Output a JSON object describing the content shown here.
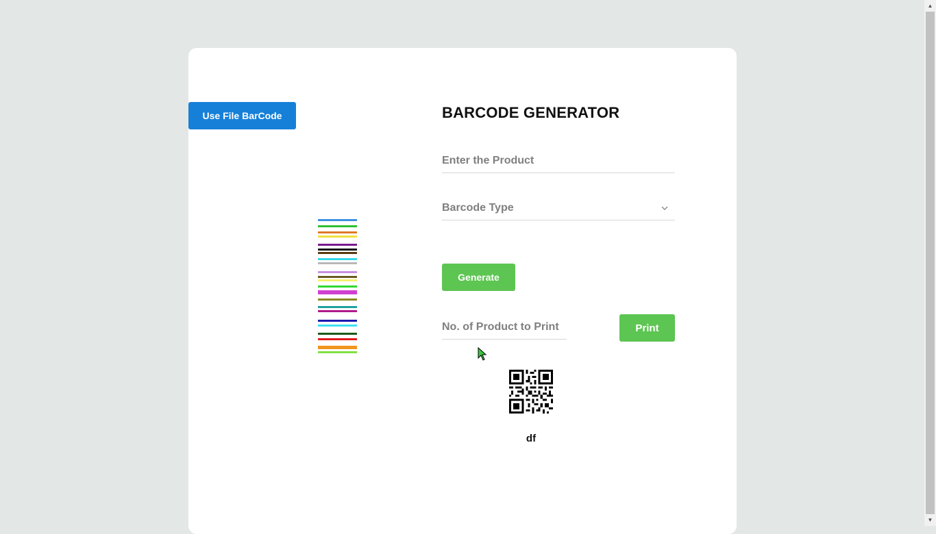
{
  "sidebar": {
    "file_barcode_button": "Use File BarCode"
  },
  "form": {
    "title": "BARCODE GENERATOR",
    "product_placeholder": "Enter the Product",
    "barcode_type_placeholder": "Barcode Type",
    "generate_label": "Generate",
    "quantity_placeholder": "No. of Product to Print",
    "print_label": "Print"
  },
  "preview": {
    "qr_text": "df"
  },
  "icons": {
    "dropdown": "chevron-down-icon",
    "illustration": "barcode-stripes-illustration",
    "qr": "qr-code-icon",
    "cursor": "mouse-cursor-icon"
  },
  "colors": {
    "background": "#e3e7e5",
    "card": "#ffffff",
    "primary_blue": "#1680d9",
    "action_green": "#5dc552"
  }
}
